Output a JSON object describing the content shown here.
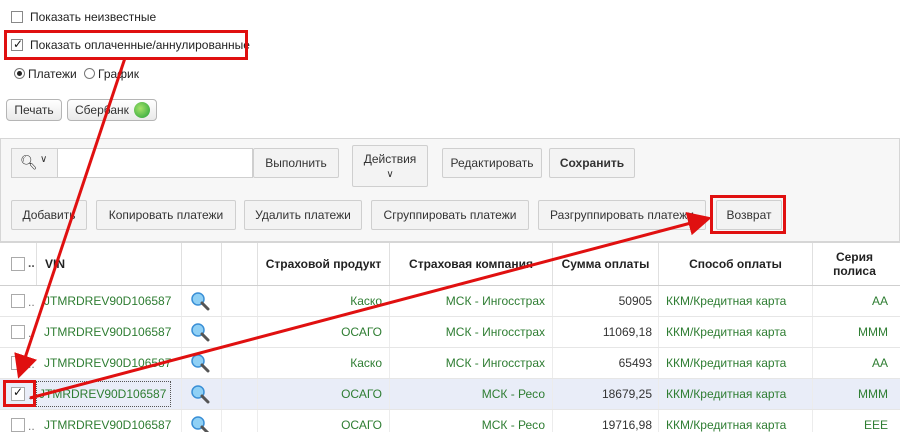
{
  "filters": {
    "show_unknown_label": "Показать неизвестные",
    "show_paid_label": "Показать оплаченные/аннулированные",
    "radio_payments_label": "Платежи",
    "radio_schedule_label": "График"
  },
  "buttons": {
    "print": "Печать",
    "sberbank": "Сбербанк"
  },
  "toolbar": {
    "search_placeholder": "",
    "execute": "Выполнить",
    "actions": "Действия",
    "edit": "Редактировать",
    "save": "Сохранить",
    "add": "Добавить",
    "copy_payments": "Копировать платежи",
    "delete_payments": "Удалить платежи",
    "group_payments": "Сгруппировать платежи",
    "ungroup_payments": "Разгруппировать платежи",
    "refund": "Возврат"
  },
  "table": {
    "columns": {
      "vin": "VIN",
      "product": "Страховой продукт",
      "company": "Страховая компания",
      "amount": "Сумма оплаты",
      "method": "Способ оплаты",
      "series": "Серия полиса"
    },
    "rows": [
      {
        "vin": "JTMRDREV90D106587",
        "product": "Каско",
        "company": "МСК - Ингосстрах",
        "amount": "50905",
        "method": "ККМ/Кредитная карта",
        "series": "АА",
        "checked": false
      },
      {
        "vin": "JTMRDREV90D106587",
        "product": "ОСАГО",
        "company": "МСК - Ингосстрах",
        "amount": "11069,18",
        "method": "ККМ/Кредитная карта",
        "series": "МММ",
        "checked": false
      },
      {
        "vin": "JTMRDREV90D106587",
        "product": "Каско",
        "company": "МСК - Ингосстрах",
        "amount": "65493",
        "method": "ККМ/Кредитная карта",
        "series": "АА",
        "checked": false
      },
      {
        "vin": "JTMRDREV90D106587",
        "product": "ОСАГО",
        "company": "МСК - Ресо",
        "amount": "18679,25",
        "method": "ККМ/Кредитная карта",
        "series": "МММ",
        "checked": true
      },
      {
        "vin": "JTMRDREV90D106587",
        "product": "ОСАГО",
        "company": "МСК - Ресо",
        "amount": "19716,98",
        "method": "ККМ/Кредитная карта",
        "series": "ЕЕЕ",
        "checked": false
      }
    ]
  },
  "colors": {
    "annotation": "#e01010",
    "link_green": "#2e7d32",
    "selected_row": "#e9edf8"
  }
}
